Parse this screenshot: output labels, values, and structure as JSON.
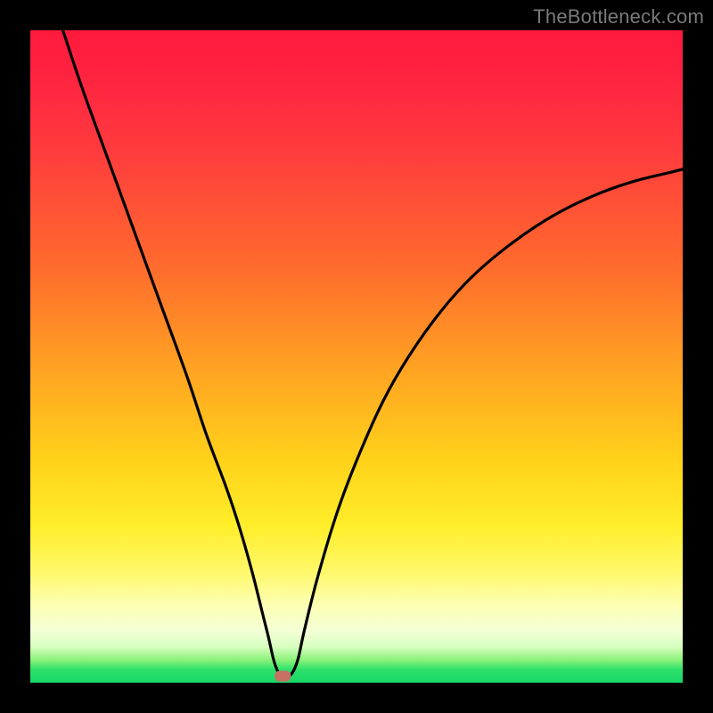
{
  "watermark": "TheBottleneck.com",
  "chart_data": {
    "type": "line",
    "title": "",
    "xlabel": "",
    "ylabel": "",
    "xlim": [
      0,
      100
    ],
    "ylim": [
      0,
      100
    ],
    "series": [
      {
        "name": "curve",
        "x": [
          5,
          8,
          12,
          16,
          20,
          24,
          27,
          30,
          32,
          34,
          35.5,
          36.5,
          37.3,
          38,
          38.5,
          39,
          40,
          41,
          42,
          44,
          47,
          50,
          54,
          58,
          63,
          68,
          74,
          80,
          86,
          92,
          98,
          100
        ],
        "y": [
          100,
          91,
          80,
          69,
          58,
          47,
          38,
          30,
          24,
          17,
          11,
          7,
          3.5,
          1.6,
          1.2,
          1.2,
          1.3,
          3.5,
          8,
          16,
          26,
          34,
          43,
          50,
          57,
          62.5,
          67.5,
          71.5,
          74.5,
          76.7,
          78.2,
          78.7
        ]
      }
    ],
    "marker": {
      "x": 38.7,
      "y": 1.0
    },
    "gradient_stops": [
      {
        "pos": 100,
        "color": "#ff1a3d"
      },
      {
        "pos": 66,
        "color": "#ffa322"
      },
      {
        "pos": 24,
        "color": "#ffee2a"
      },
      {
        "pos": 4,
        "color": "#8cf27a"
      },
      {
        "pos": 0,
        "color": "#18d968"
      }
    ]
  }
}
